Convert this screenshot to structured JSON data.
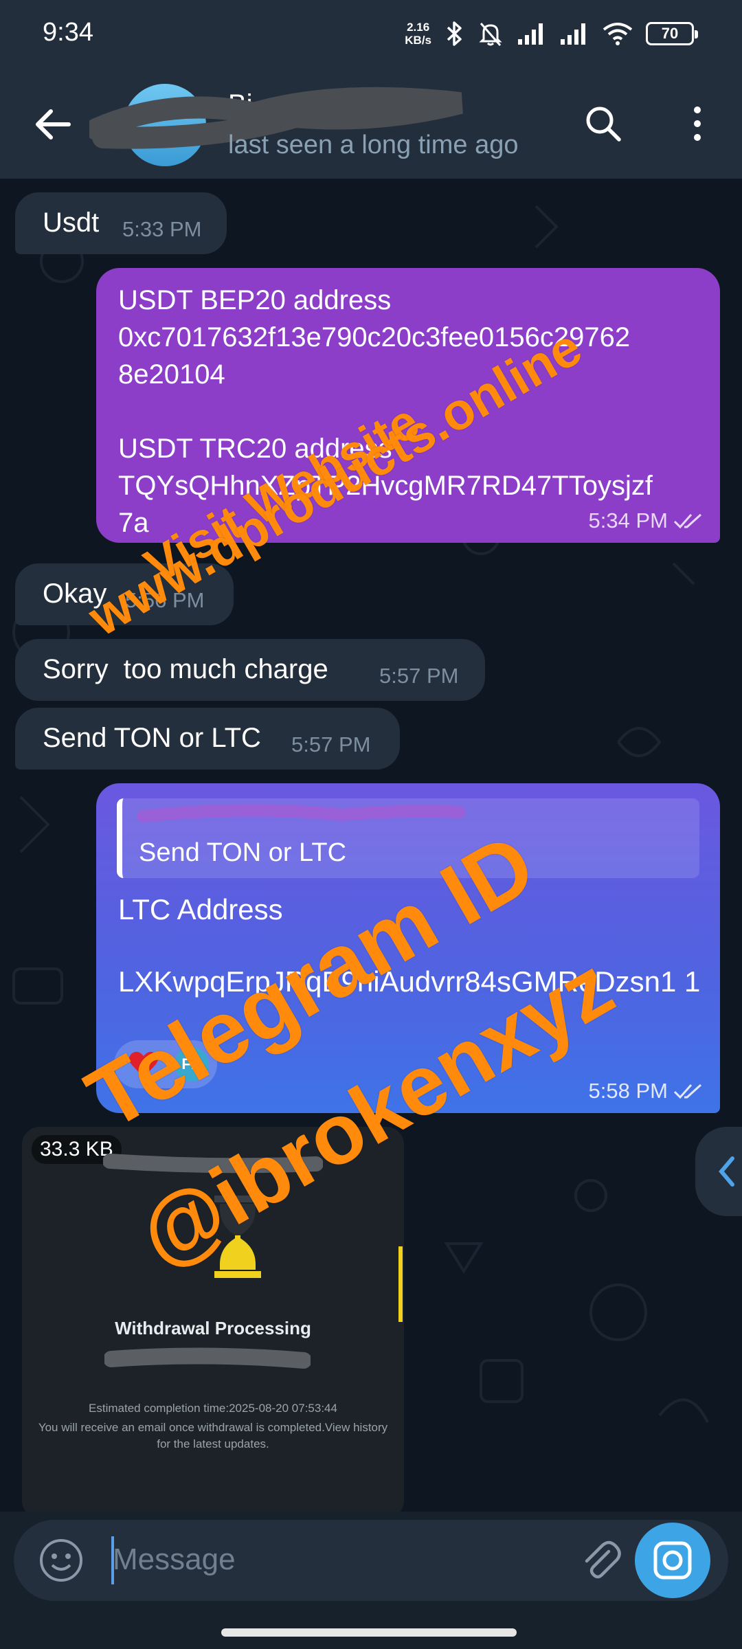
{
  "status_bar": {
    "time": "9:34",
    "net_speed_value": "2.16",
    "net_speed_unit": "KB/s",
    "battery": "70"
  },
  "header": {
    "contact_name": "Bi...",
    "last_seen": "last seen a long time ago",
    "icons": [
      "back-arrow-icon",
      "search-icon",
      "more-vert-icon"
    ]
  },
  "messages": [
    {
      "direction": "in",
      "text": "Usdt",
      "time": "5:33 PM"
    },
    {
      "direction": "out",
      "text": "USDT BEP20 address\n0xc7017632f13e790c20c3fee0156c29762\n8e20104\n\nUSDT TRC20 address\nTQYsQHhnXZpTP2HvcgMR7RD47TToysjzf\n7a",
      "time": "5:34 PM"
    },
    {
      "direction": "in",
      "text": "Okay",
      "time": "5:56 PM"
    },
    {
      "direction": "in",
      "text": "Sorry  too much charge",
      "time": "5:57 PM"
    },
    {
      "direction": "in",
      "text": "Send TON or LTC",
      "time": "5:57 PM"
    },
    {
      "direction": "out",
      "reply_to": "Send TON or LTC",
      "label": "LTC Address",
      "address": "LXKwpqErpJRqE9hiAudvrr84sGMReDzsn1\n1",
      "reaction_avatar": "FD",
      "time": "5:58 PM"
    }
  ],
  "photo": {
    "file_size": "33.3 KB",
    "title": "Withdrawal Processing",
    "line1": "Estimated completion time:2025-08-20 07:53:44",
    "line2": "You will receive an email once withdrawal is completed.View history for the latest updates."
  },
  "watermarks": {
    "line1": "Visit Website",
    "line2": "www.dproducts.online",
    "line3": "Telegram ID",
    "line4": "@ibrokenxyz"
  },
  "input": {
    "placeholder": "Message"
  },
  "colors": {
    "header_bg": "#232e3c",
    "chat_bg": "#0e1621",
    "incoming_bubble": "#242f3d",
    "outgoing_bubble_purple": "#8c3ec9",
    "outgoing_bubble_blue": "#4f64e0",
    "watermark": "#ff8a0c",
    "accent": "#3da4e6"
  }
}
